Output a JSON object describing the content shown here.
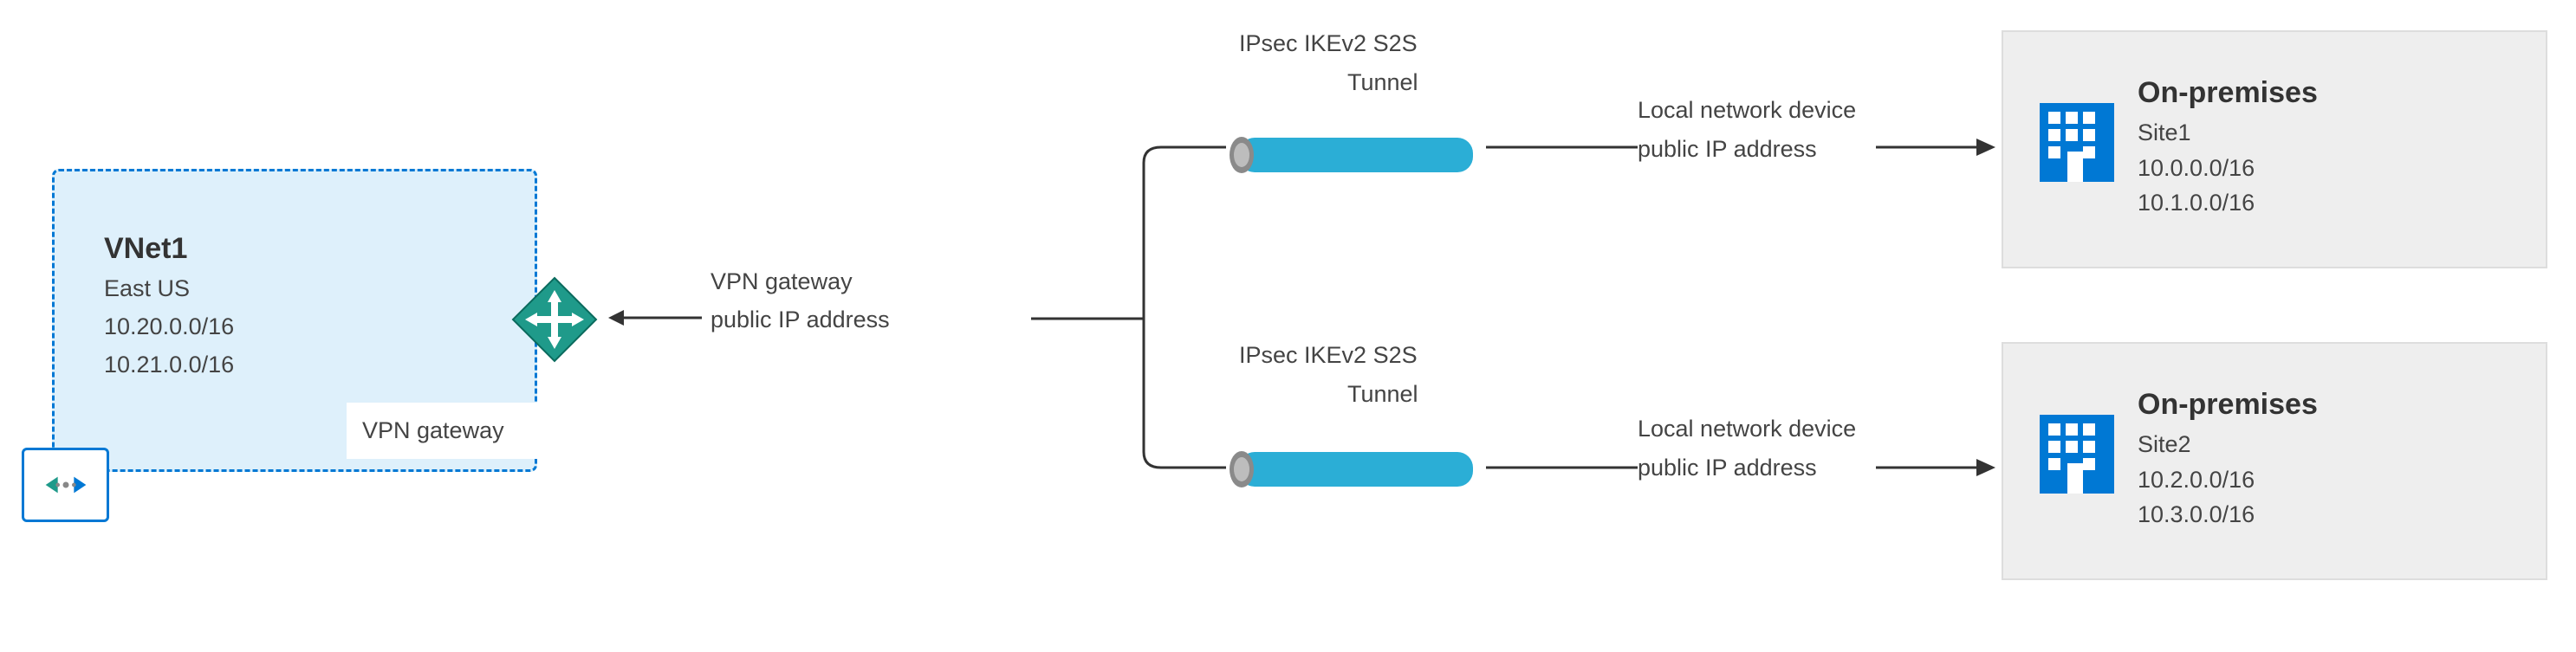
{
  "vnet": {
    "title": "VNet1",
    "region": "East US",
    "cidrs": [
      "10.20.0.0/16",
      "10.21.0.0/16"
    ],
    "gateway_label": "VPN gateway"
  },
  "gateway_info": {
    "line1": "VPN gateway",
    "line2": "public IP address"
  },
  "tunnels": {
    "top": {
      "line1": "IPsec IKEv2 S2S",
      "line2": "Tunnel"
    },
    "bottom": {
      "line1": "IPsec IKEv2 S2S",
      "line2": "Tunnel"
    }
  },
  "local_device": {
    "top": {
      "line1": "Local network device",
      "line2": "public IP address"
    },
    "bottom": {
      "line1": "Local network device",
      "line2": "public IP address"
    }
  },
  "sites": {
    "site1": {
      "heading": "On-premises",
      "name": "Site1",
      "cidrs": [
        "10.0.0.0/16",
        "10.1.0.0/16"
      ]
    },
    "site2": {
      "heading": "On-premises",
      "name": "Site2",
      "cidrs": [
        "10.2.0.0/16",
        "10.3.0.0/16"
      ]
    }
  },
  "colors": {
    "azure_blue": "#0078D4",
    "tunnel": "#2BAED6",
    "gw_fill": "#1F9A8A"
  }
}
